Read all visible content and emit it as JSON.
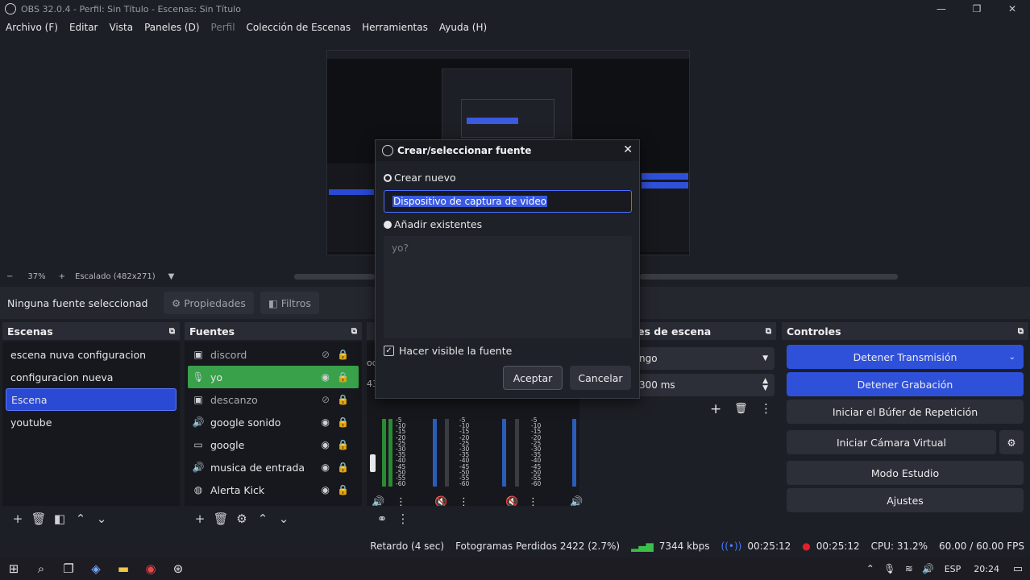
{
  "window": {
    "title": "OBS 32.0.4 - Perfil: Sin Título - Escenas: Sin Título",
    "min": "—",
    "max": "❐",
    "close": "✕"
  },
  "menu": [
    {
      "label": "Archivo (F)",
      "enabled": true
    },
    {
      "label": "Editar",
      "enabled": true
    },
    {
      "label": "Vista",
      "enabled": true
    },
    {
      "label": "Paneles (D)",
      "enabled": true
    },
    {
      "label": "Perfil",
      "enabled": false
    },
    {
      "label": "Colección de Escenas",
      "enabled": true
    },
    {
      "label": "Herramientas",
      "enabled": true
    },
    {
      "label": "Ayuda (H)",
      "enabled": true
    }
  ],
  "zoom": {
    "minus": "−",
    "value": "37%",
    "plus": "+",
    "scale": "Escalado (482x271)"
  },
  "properties_bar": {
    "no_source": "Ninguna fuente seleccionad",
    "properties": "Propiedades",
    "filters": "Filtros"
  },
  "scenes": {
    "title": "Escenas",
    "items": [
      {
        "label": "escena nuva configuracion",
        "selected": false
      },
      {
        "label": "configuracion nueva",
        "selected": false
      },
      {
        "label": "Escena",
        "selected": true
      },
      {
        "label": "youtube",
        "selected": false
      }
    ]
  },
  "sources": {
    "title": "Fuentes",
    "items": [
      {
        "label": "discord",
        "icon": "image-icon",
        "visible": false
      },
      {
        "label": "yo",
        "icon": "mic-icon",
        "visible": true
      },
      {
        "label": "descanzo",
        "icon": "image-icon",
        "visible": false
      },
      {
        "label": "google sonido",
        "icon": "speaker-icon",
        "visible": true
      },
      {
        "label": "google",
        "icon": "monitor-icon",
        "visible": true
      },
      {
        "label": "musica de entrada",
        "icon": "speaker-icon",
        "visible": true
      },
      {
        "label": "Alerta Kick",
        "icon": "globe-icon",
        "visible": true
      }
    ]
  },
  "transitions": {
    "title_partial": "es de escena",
    "transition_value": "ngo",
    "duration": "300 ms"
  },
  "mixer": {
    "channel_partial": "oc",
    "level_partial": "43",
    "scale": [
      "-5",
      "-10",
      "-15",
      "-20",
      "-25",
      "-30",
      "-35",
      "-40",
      "-45",
      "-50",
      "-55",
      "-60"
    ]
  },
  "controls": {
    "title": "Controles",
    "buttons": [
      {
        "label": "Detener Transmisión",
        "active": true
      },
      {
        "label": "Detener Grabación",
        "active": true
      },
      {
        "label": "Iniciar el Búfer de Repetición",
        "active": false
      },
      {
        "label": "Iniciar Cámara Virtual",
        "active": false
      },
      {
        "label": "Modo Estudio",
        "active": false
      },
      {
        "label": "Ajustes",
        "active": false
      }
    ]
  },
  "dialog": {
    "title": "Crear/seleccionar fuente",
    "create_new": "Crear nuevo",
    "name_value": "Dispositivo de captura de video",
    "add_existing": "Añadir existentes",
    "existing_items": [
      "yo?"
    ],
    "make_visible": "Hacer visible la fuente",
    "make_visible_checked": true,
    "ok": "Aceptar",
    "cancel": "Cancelar"
  },
  "status": {
    "delay": "Retardo (4 sec)",
    "dropped": "Fotogramas Perdidos 2422 (2.7%)",
    "bitrate": "7344 kbps",
    "stream_time": "00:25:12",
    "rec_time": "00:25:12",
    "cpu": "CPU: 31.2%",
    "fps": "60.00 / 60.00 FPS"
  },
  "taskbar": {
    "lang": "ESP",
    "time": "20:24"
  },
  "colors": {
    "accent": "#2f51d9",
    "selected_source": "#39a14a",
    "recording": "#e0202a"
  }
}
